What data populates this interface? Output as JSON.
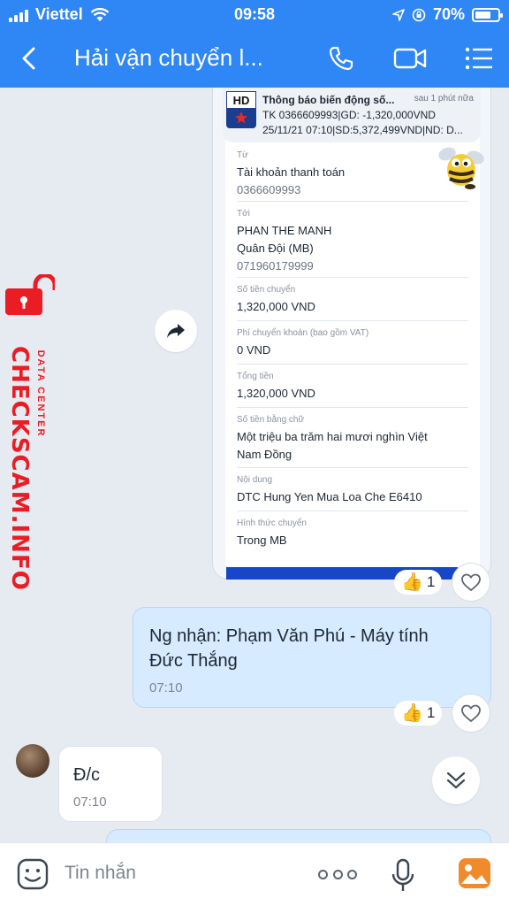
{
  "status_bar": {
    "carrier": "Viettel",
    "time": "09:58",
    "battery_percent": "70%",
    "battery_level": 0.7
  },
  "header": {
    "title": "Hải vận chuyển l..."
  },
  "receipt": {
    "notification": {
      "app_badge": "HD",
      "title": "Thông báo biến động số...",
      "since": "sau 1 phút nữa",
      "line1": "TK 0366609993|GD: -1,320,000VND",
      "line2": "25/11/21 07:10|SD:5,372,499VND|ND: D..."
    },
    "fields": [
      {
        "label": "Từ",
        "value": "Tài khoản thanh toán",
        "sub": "0366609993"
      },
      {
        "label": "Tới",
        "value": "PHAN THE MANH",
        "value2": "Quân Đội (MB)",
        "sub": "071960179999"
      },
      {
        "label": "Số tiền chuyển",
        "value": "1,320,000 VND"
      },
      {
        "label": "Phí chuyển khoản (bao gồm VAT)",
        "value": "0 VND"
      },
      {
        "label": "Tổng tiền",
        "value": "1,320,000 VND"
      },
      {
        "label": "Số tiền bằng chữ",
        "value": "Một triệu ba trăm hai mươi nghìn Việt",
        "value2": "Nam Đồng"
      },
      {
        "label": "Nội dung",
        "value": "DTC Hung Yen Mua Loa Che E6410"
      },
      {
        "label": "Hình thức chuyển",
        "value": "Trong MB"
      }
    ],
    "reaction_count": "1"
  },
  "messages": [
    {
      "direction": "out",
      "text_line1": "Ng nhận: Phạm Văn Phú - Máy tính",
      "text_line2": "Đức Thắng",
      "time": "07:10",
      "reaction_count": "1"
    },
    {
      "direction": "in",
      "text": "Đ/c",
      "time": "07:10"
    }
  ],
  "input": {
    "placeholder": "Tin nhắn"
  },
  "watermark": {
    "brand": "CHECKSCAM.INFO",
    "subtitle": "DATA CENTER"
  },
  "colors": {
    "header_blue": "#2f87f5",
    "outgoing_bubble": "#d6ebff",
    "watermark_red": "#ea1c24"
  }
}
